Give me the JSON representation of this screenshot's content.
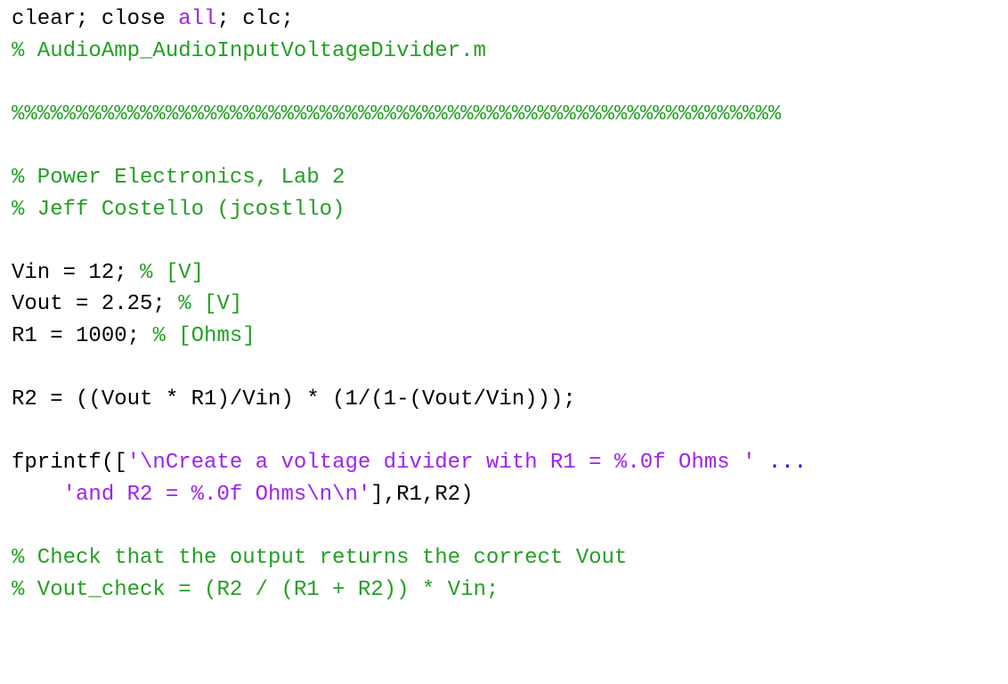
{
  "colors": {
    "plain": "#000000",
    "string": "#a020f0",
    "comment": "#22a022",
    "continuation": "#0000ff",
    "background": "#ffffff"
  },
  "code": {
    "l1": {
      "t1": "clear; close ",
      "t2": "all",
      "t3": "; clc;"
    },
    "l2": {
      "t1": "% AudioAmp_AudioInputVoltageDivider.m"
    },
    "l4": {
      "t1": "%%%%%%%%%%%%%%%%%%%%%%%%%%%%%%%%%%%%%%%%%%%%%%%%%%%%%%%%%%%%"
    },
    "l6": {
      "t1": "% Power Electronics, Lab 2"
    },
    "l7": {
      "t1": "% Jeff Costello (jcostllo)"
    },
    "l9": {
      "t1": "Vin = 12; ",
      "t2": "% [V]"
    },
    "l10": {
      "t1": "Vout = 2.25; ",
      "t2": "% [V]"
    },
    "l11": {
      "t1": "R1 = 1000; ",
      "t2": "% [Ohms]"
    },
    "l13": {
      "t1": "R2 = ((Vout * R1)/Vin) * (1/(1-(Vout/Vin)));"
    },
    "l15": {
      "t1": "fprintf([",
      "t2": "'\\nCreate a voltage divider with R1 = %.0f Ohms '",
      "t3": " ..."
    },
    "l16": {
      "t1": "    ",
      "t2": "'and R2 = %.0f Ohms\\n\\n'",
      "t3": "],R1,R2)"
    },
    "l18": {
      "t1": "% Check that the output returns the correct Vout"
    },
    "l19": {
      "t1": "% Vout_check = (R2 / (R1 + R2)) * Vin;"
    }
  }
}
